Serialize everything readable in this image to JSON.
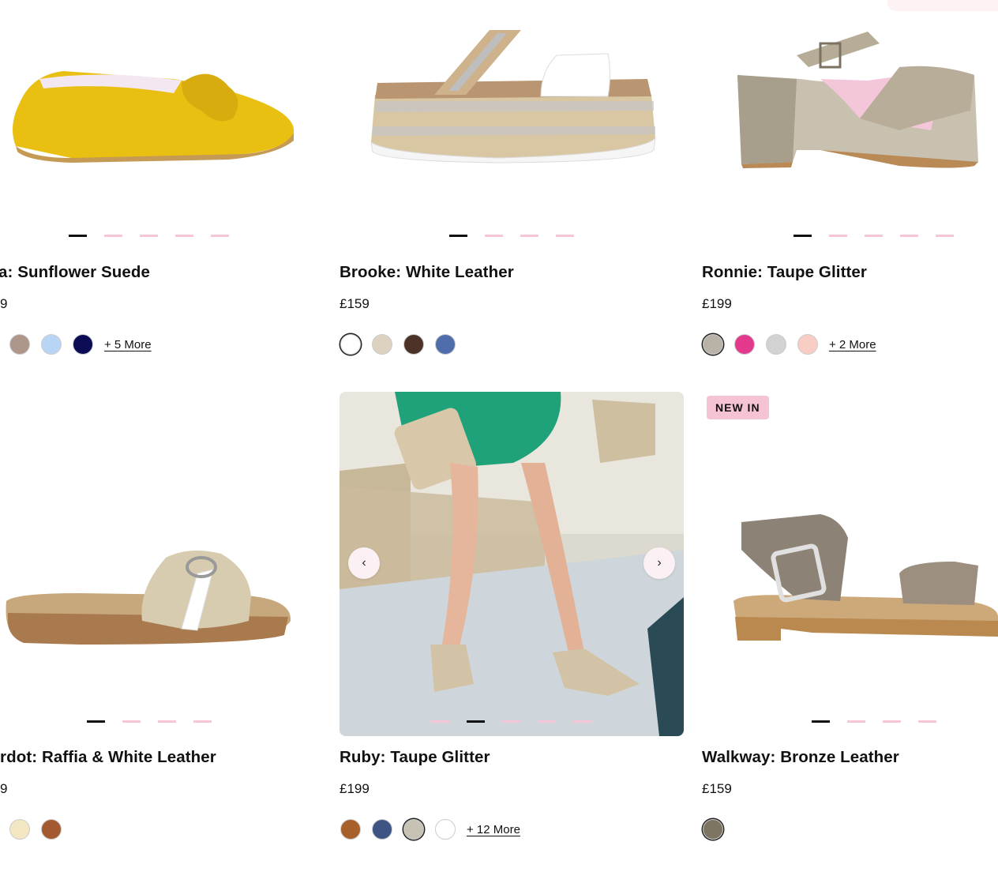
{
  "products": [
    {
      "title": "a: Sunflower Suede",
      "price": "9",
      "more": "+ 5 More",
      "swatches": [
        "#ad978a",
        "#b9d5f5",
        "#0c0c55"
      ],
      "image": "yellow-bow-flat"
    },
    {
      "title": "Brooke: White Leather",
      "price": "£159",
      "more": "",
      "swatches": [
        "#ffffff",
        "#ddd2c0",
        "#4d3327",
        "#4f6daa"
      ],
      "image": "white-platform-espadrille-sandal"
    },
    {
      "title": "Ronnie: Taupe Glitter",
      "price": "£199",
      "more": "+ 2 More",
      "swatches": [
        "#b9b3a7",
        "#e3398c",
        "#d2d2d2",
        "#f7cdc4"
      ],
      "image": "taupe-glitter-block-heel"
    },
    {
      "title": "rdot: Raffia & White Leather",
      "price": "9",
      "more": "",
      "swatches": [
        "#f3e6c3",
        "#a45a30"
      ],
      "image": "raffia-slide-sandal"
    },
    {
      "title": "Ruby: Taupe Glitter",
      "price": "£199",
      "more": "+ 12 More",
      "swatches": [
        "#a7602a",
        "#3e5584",
        "#c8c2b5",
        "#ffffff"
      ],
      "image": "model-wearing-glitter-heels"
    },
    {
      "title": "Walkway: Bronze Leather",
      "price": "£159",
      "more": "",
      "badge": "NEW IN",
      "swatches": [
        "#7d7462"
      ],
      "image": "bronze-buckle-sandal"
    }
  ],
  "carousel": {
    "prev_icon": "chevron-left-icon",
    "next_icon": "chevron-right-icon",
    "prev_glyph": "‹",
    "next_glyph": "›"
  },
  "colors": {
    "accent_pink": "#f5c3d3",
    "dot_active": "#111111"
  }
}
